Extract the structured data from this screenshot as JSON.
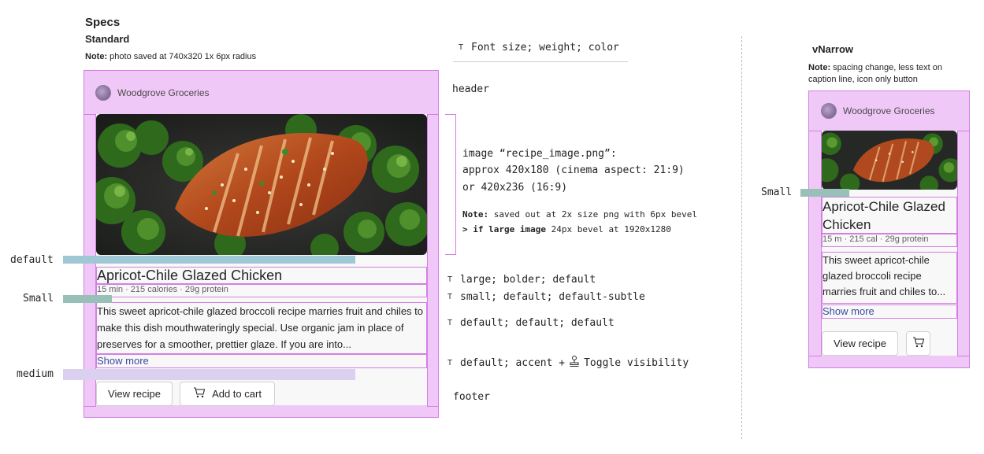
{
  "headings": {
    "specs": "Specs",
    "standard": "Standard",
    "note_label": "Note:",
    "note_standard": " photo saved at 740x320 1x 6px radius",
    "narrow": "vNarrow",
    "note_narrow": " spacing change, less text on caption line, icon only button"
  },
  "card": {
    "brand": "Woodgrove Groceries",
    "title": "Apricot-Chile Glazed Chicken",
    "subtitle": "15 min · 215 calories · 29g protein",
    "description": "This sweet apricot-chile glazed broccoli recipe marries fruit and chiles to make this dish mouthwateringly special. Use organic jam in place of preserves for a smoother, prettier glaze. If you are into...",
    "show_more": "Show more",
    "view_recipe": "View recipe",
    "add_to_cart": "Add to cart"
  },
  "narrow_card": {
    "brand": "Woodgrove Groceries",
    "title": "Apricot-Chile Glazed Chicken",
    "subtitle": "15 m · 215 cal · 29g protein",
    "description": "This sweet apricot-chile glazed broccoli recipe marries fruit and chiles to...",
    "show_more": "Show more",
    "view_recipe": "View recipe"
  },
  "left_labels": {
    "default": "default",
    "small": "Small",
    "medium": "medium",
    "narrow_small": "Small"
  },
  "annotations": {
    "legend": "Font size; weight; color",
    "header": "header",
    "image_line1": "image “recipe_image.png”:",
    "image_line2": "approx 420x180 (cinema aspect: 21:9)",
    "image_line3": "or 420x236 (16:9)",
    "image_note_label": "Note:",
    "image_note_text": " saved out at 2x size png with 6px bevel",
    "image_note2_label": "> if large image",
    "image_note2_text": " 24px bevel at 1920x1280",
    "title_spec": "large; bolder; default",
    "subtitle_spec": "small; default; default-subtle",
    "desc_spec": "default; default; default",
    "show_spec": "default; accent + ",
    "toggle": "Toggle visibility",
    "footer": "footer"
  },
  "colors": {
    "frame": "#f0c8f7",
    "frame_border": "#d47fe4",
    "bar_teal": "#9fc8d4",
    "bar_sage": "#98bfb8",
    "bar_lilac": "#dcd0f0",
    "accent": "#3a4aa0"
  },
  "icons": [
    "t-icon",
    "cart-icon",
    "stamp-icon",
    "brand-logo"
  ]
}
